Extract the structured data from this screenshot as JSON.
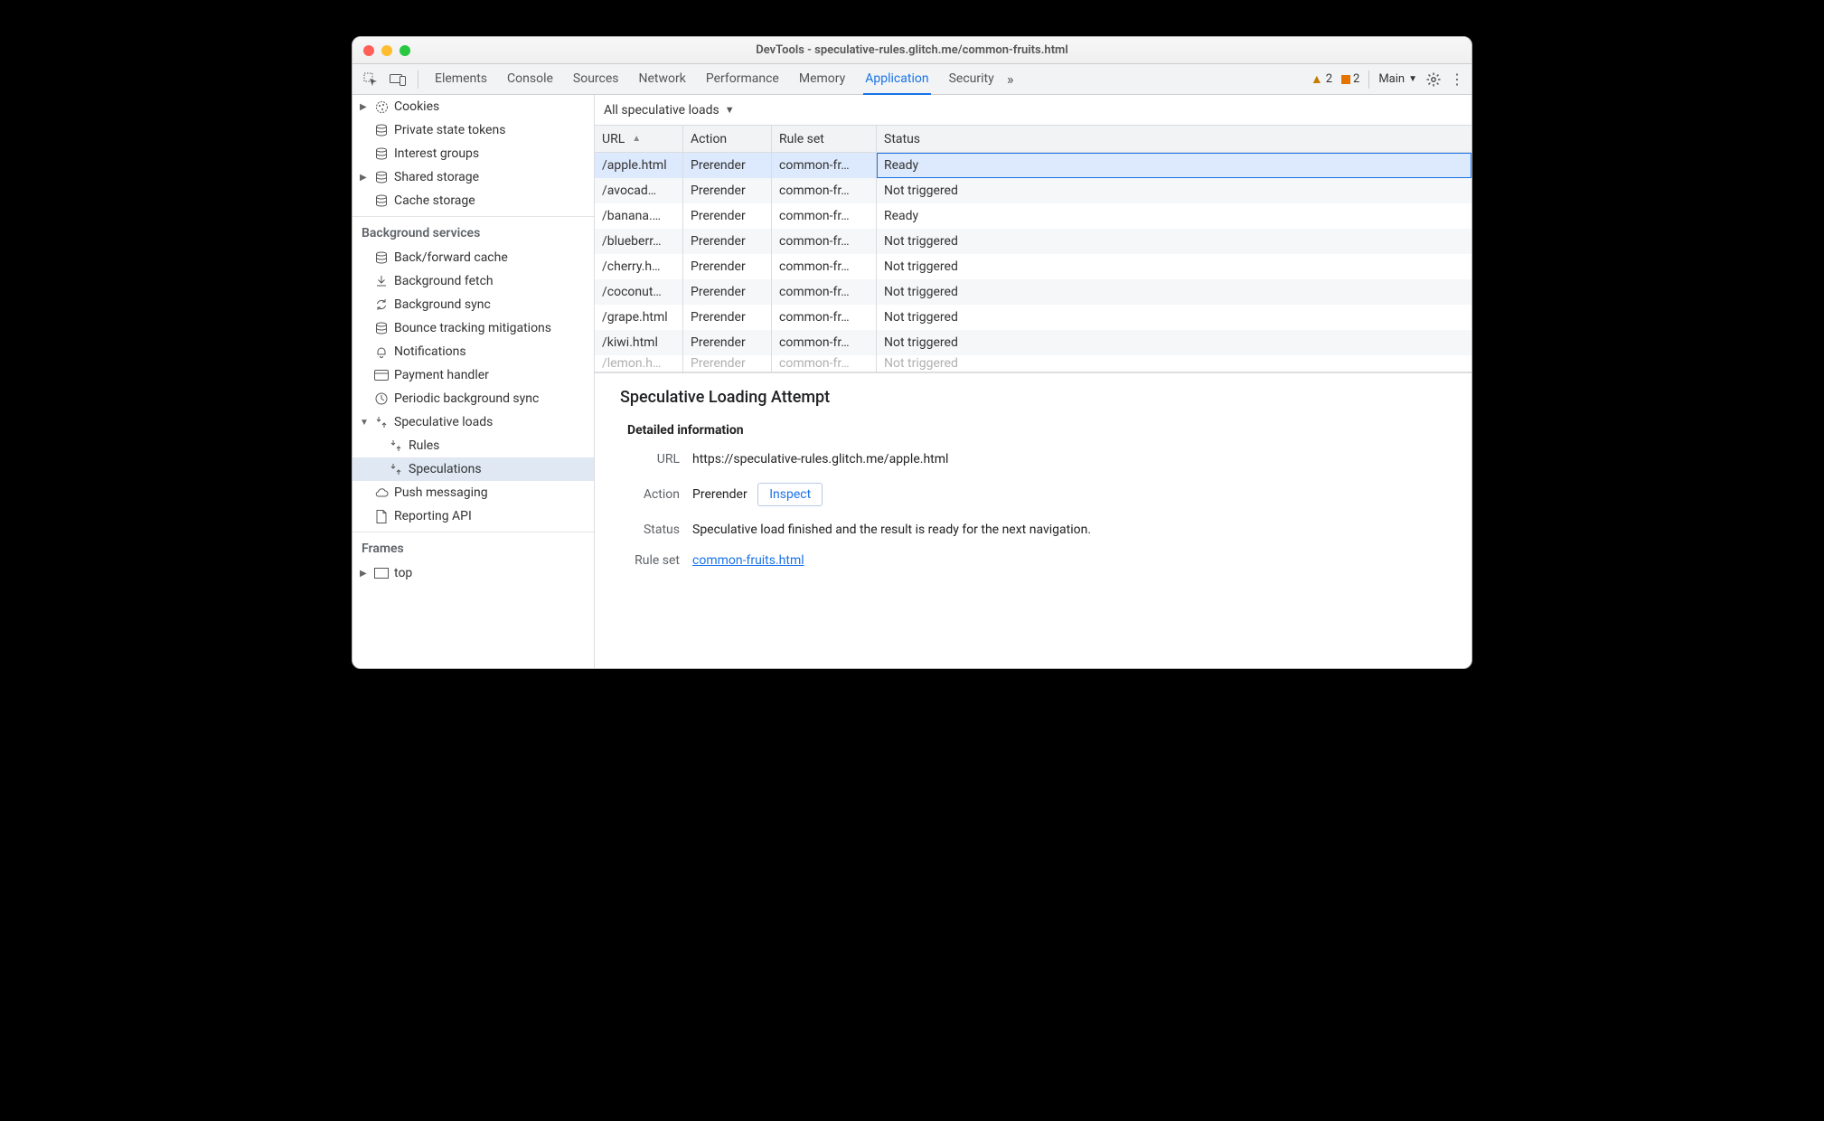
{
  "window": {
    "title": "DevTools - speculative-rules.glitch.me/common-fruits.html"
  },
  "tabs": {
    "items": [
      "Elements",
      "Console",
      "Sources",
      "Network",
      "Performance",
      "Memory",
      "Application",
      "Security"
    ],
    "active": "Application",
    "more_glyph": "»"
  },
  "toolbar": {
    "warnings_count": "2",
    "issues_count": "2",
    "context_label": "Main"
  },
  "sidebar": {
    "storage": [
      {
        "label": "Cookies",
        "icon": "cookie",
        "expandable": true
      },
      {
        "label": "Private state tokens",
        "icon": "db"
      },
      {
        "label": "Interest groups",
        "icon": "db"
      },
      {
        "label": "Shared storage",
        "icon": "db",
        "expandable": true
      },
      {
        "label": "Cache storage",
        "icon": "db"
      }
    ],
    "bg_heading": "Background services",
    "bg": [
      {
        "label": "Back/forward cache",
        "icon": "db"
      },
      {
        "label": "Background fetch",
        "icon": "fetch"
      },
      {
        "label": "Background sync",
        "icon": "sync"
      },
      {
        "label": "Bounce tracking mitigations",
        "icon": "db"
      },
      {
        "label": "Notifications",
        "icon": "bell"
      },
      {
        "label": "Payment handler",
        "icon": "card"
      },
      {
        "label": "Periodic background sync",
        "icon": "clock"
      },
      {
        "label": "Speculative loads",
        "icon": "spec",
        "expandable": true,
        "expanded": true,
        "children": [
          {
            "label": "Rules",
            "icon": "spec"
          },
          {
            "label": "Speculations",
            "icon": "spec",
            "selected": true
          }
        ]
      },
      {
        "label": "Push messaging",
        "icon": "cloud"
      },
      {
        "label": "Reporting API",
        "icon": "doc"
      }
    ],
    "frames_heading": "Frames",
    "frames_top_label": "top"
  },
  "filter": {
    "label": "All speculative loads"
  },
  "columns": [
    "URL",
    "Action",
    "Rule set",
    "Status"
  ],
  "rows": [
    {
      "url": "/apple.html",
      "action": "Prerender",
      "ruleset": "common-fr…",
      "status": "Ready",
      "selected": true
    },
    {
      "url": "/avocad…",
      "action": "Prerender",
      "ruleset": "common-fr…",
      "status": "Not triggered"
    },
    {
      "url": "/banana.…",
      "action": "Prerender",
      "ruleset": "common-fr…",
      "status": "Ready"
    },
    {
      "url": "/blueberr…",
      "action": "Prerender",
      "ruleset": "common-fr…",
      "status": "Not triggered"
    },
    {
      "url": "/cherry.h…",
      "action": "Prerender",
      "ruleset": "common-fr…",
      "status": "Not triggered"
    },
    {
      "url": "/coconut…",
      "action": "Prerender",
      "ruleset": "common-fr…",
      "status": "Not triggered"
    },
    {
      "url": "/grape.html",
      "action": "Prerender",
      "ruleset": "common-fr…",
      "status": "Not triggered"
    },
    {
      "url": "/kiwi.html",
      "action": "Prerender",
      "ruleset": "common-fr…",
      "status": "Not triggered"
    },
    {
      "url": "/lemon.h…",
      "action": "Prerender",
      "ruleset": "common-fr…",
      "status": "Not triggered",
      "peek": true
    }
  ],
  "detail": {
    "heading": "Speculative Loading Attempt",
    "subheading": "Detailed information",
    "url_label": "URL",
    "url_value": "https://speculative-rules.glitch.me/apple.html",
    "action_label": "Action",
    "action_value": "Prerender",
    "inspect_label": "Inspect",
    "status_label": "Status",
    "status_value": "Speculative load finished and the result is ready for the next navigation.",
    "ruleset_label": "Rule set",
    "ruleset_link": "common-fruits.html"
  }
}
